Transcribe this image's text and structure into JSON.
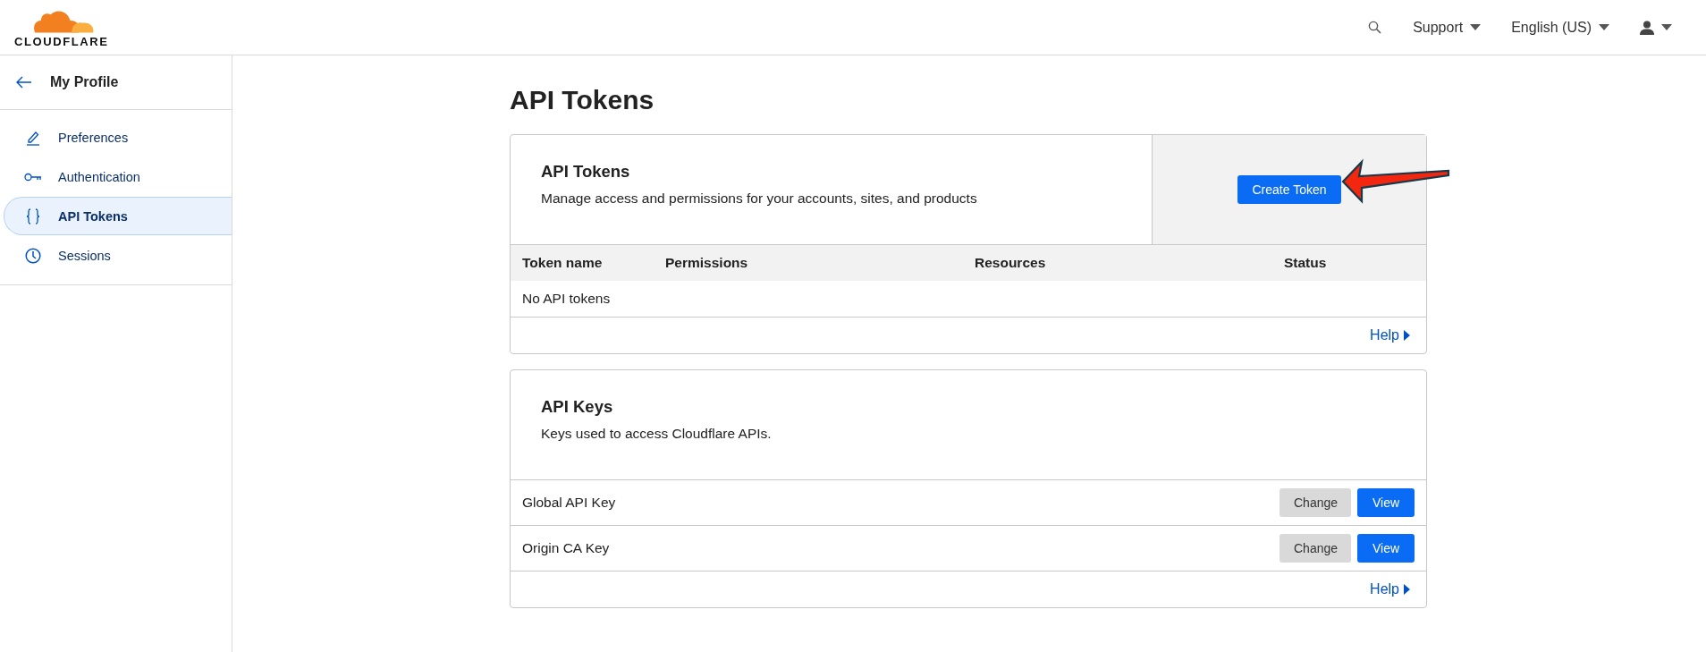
{
  "header": {
    "logo_text": "CLOUDFLARE",
    "menus": [
      {
        "label": "Support"
      },
      {
        "label": "English (US)"
      }
    ]
  },
  "sidebar": {
    "back_label": "My Profile",
    "items": [
      {
        "label": "Preferences",
        "kind": "pencil",
        "selected": false
      },
      {
        "label": "Authentication",
        "kind": "key",
        "selected": false
      },
      {
        "label": "API Tokens",
        "kind": "braces",
        "selected": true
      },
      {
        "label": "Sessions",
        "kind": "clock",
        "selected": false
      }
    ]
  },
  "page_title": "API Tokens",
  "tokens_card": {
    "title": "API Tokens",
    "description": "Manage access and permissions for your accounts, sites, and products",
    "create_button": "Create Token",
    "columns": [
      "Token name",
      "Permissions",
      "Resources",
      "Status"
    ],
    "empty_text": "No API tokens",
    "help_link": "Help"
  },
  "keys_card": {
    "title": "API Keys",
    "description": "Keys used to access Cloudflare APIs.",
    "rows": [
      {
        "name": "Global API Key",
        "buttons": [
          {
            "label": "Change",
            "kind": "secondary"
          },
          {
            "label": "View",
            "kind": "primary"
          }
        ]
      },
      {
        "name": "Origin CA Key",
        "buttons": [
          {
            "label": "Change",
            "kind": "secondary"
          },
          {
            "label": "View",
            "kind": "primary"
          }
        ]
      }
    ],
    "help_link": "Help"
  }
}
